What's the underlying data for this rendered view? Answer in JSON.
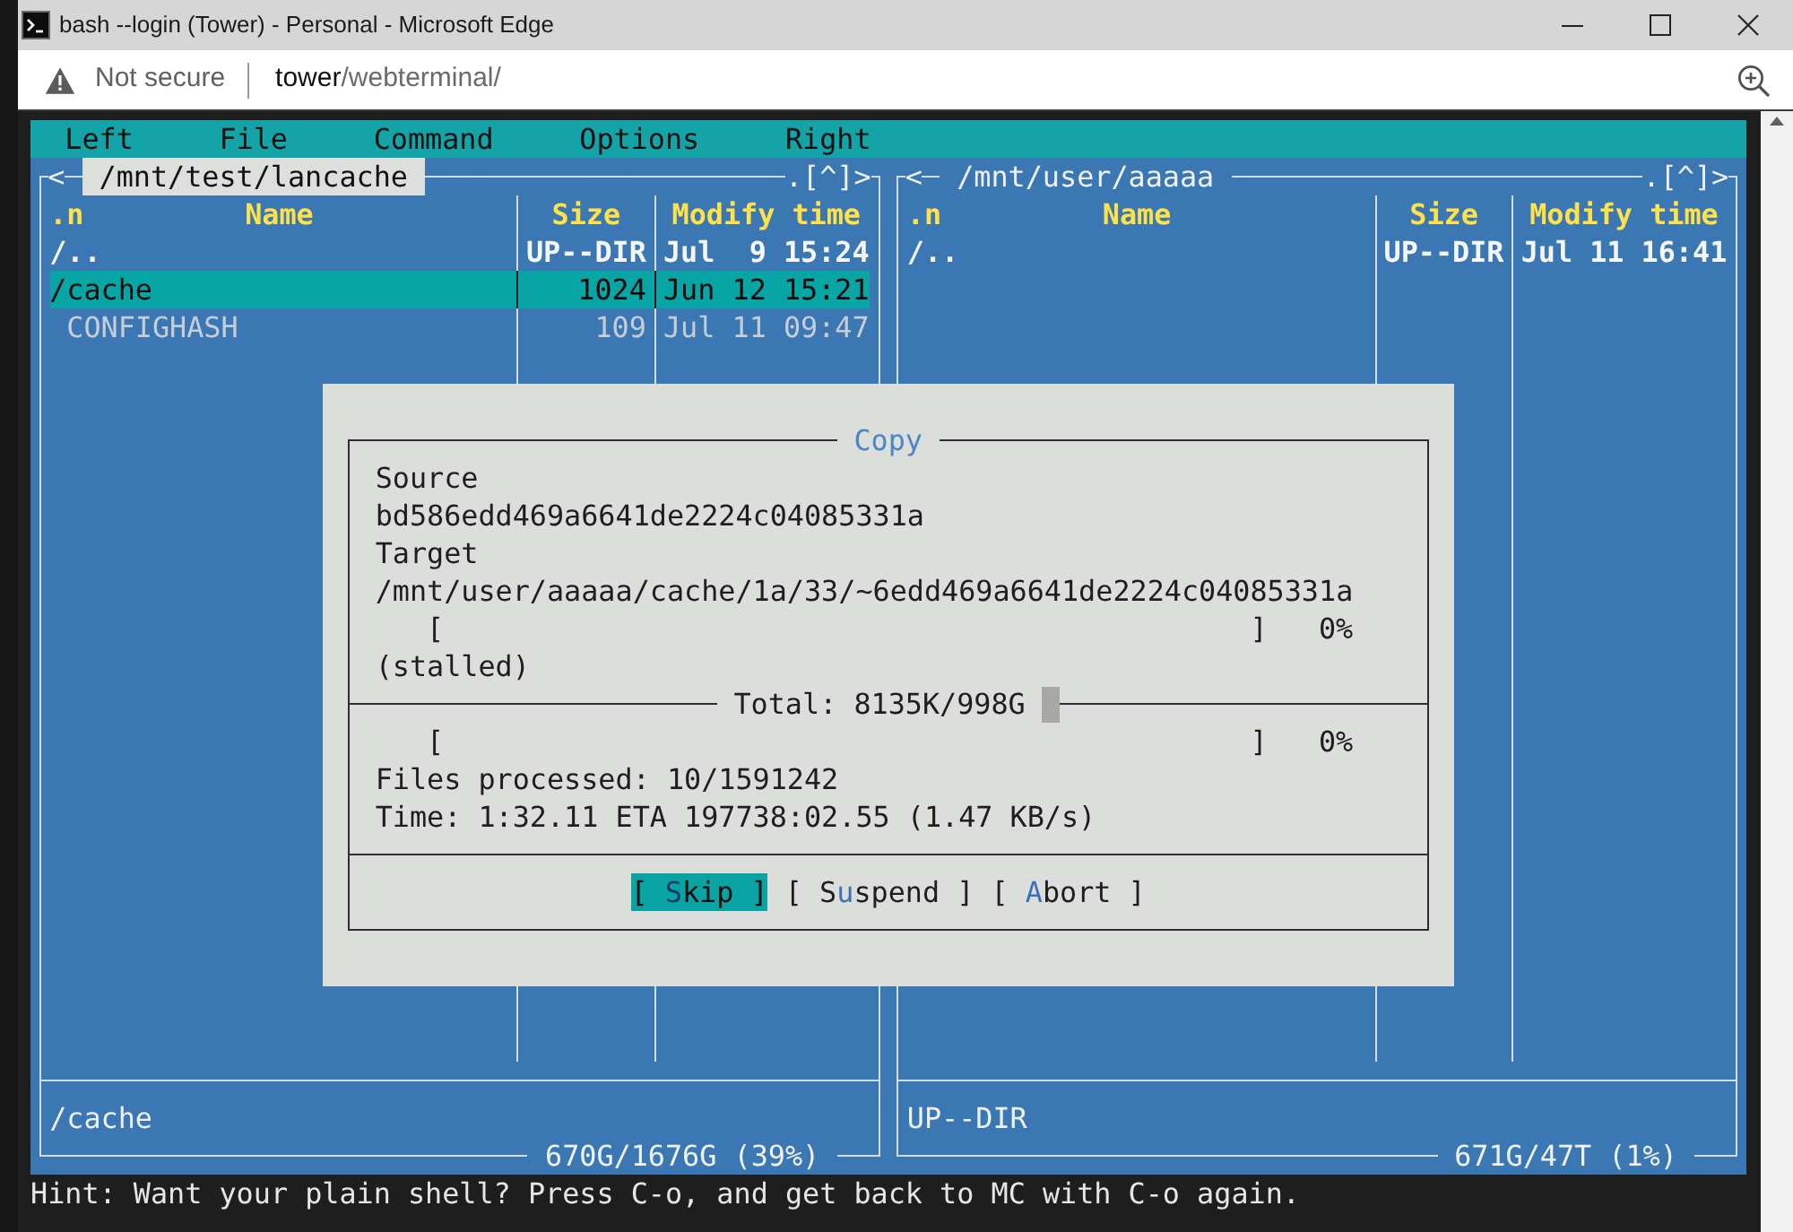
{
  "window": {
    "title": "bash --login (Tower) - Personal - Microsoft Edge"
  },
  "address_bar": {
    "security": "Not secure",
    "host": "tower",
    "path": "/webterminal/"
  },
  "menu_bar": [
    "Left",
    "File",
    "Command",
    "Options",
    "Right"
  ],
  "panels": [
    {
      "active": true,
      "title_left": "<",
      "path": "/mnt/test/lancache",
      "title_right": ".[^]>",
      "sort_indicator": ".n",
      "columns": [
        "Name",
        "Size",
        "Modify time"
      ],
      "rows": [
        {
          "kind": "dir",
          "name": "/..",
          "size": "UP--DIR",
          "modified": "Jul  9 15:24",
          "selected": false
        },
        {
          "kind": "dir",
          "name": "/cache",
          "size": "1024",
          "modified": "Jun 12 15:21",
          "selected": true
        },
        {
          "kind": "file",
          "name": "CONFIGHASH",
          "size": "109",
          "modified": "Jul 11 09:47",
          "selected": false
        }
      ],
      "mini_status": "/cache",
      "disk_info": "670G/1676G (39%)"
    },
    {
      "active": false,
      "title_left": "<",
      "path": "/mnt/user/aaaaa",
      "title_right": ".[^]>",
      "sort_indicator": ".n",
      "columns": [
        "Name",
        "Size",
        "Modify time"
      ],
      "rows": [
        {
          "kind": "dir",
          "name": "/..",
          "size": "UP--DIR",
          "modified": "Jul 11 16:41",
          "selected": false
        }
      ],
      "mini_status": "UP--DIR",
      "disk_info": "671G/47T (1%)"
    }
  ],
  "copy_dialog": {
    "title": "Copy",
    "source_label": "Source",
    "source": "bd586edd469a6641de2224c04085331a",
    "target_label": "Target",
    "target": "/mnt/user/aaaaa/cache/1a/33/~6edd469a6641de2224c04085331a",
    "file_progress": {
      "open": "[",
      "close": "]",
      "level": 0,
      "percent": "0%"
    },
    "file_status": "(stalled)",
    "total": "Total: 8135K/998G",
    "total_progress": {
      "open": "[",
      "close": "]",
      "level": 0,
      "percent": "0%"
    },
    "files_processed": "Files processed: 10/1591242",
    "time": "Time: 1:32.11 ETA 197738:02.55 (1.47 KB/s)",
    "buttons": [
      {
        "open": "[",
        "hotkey": "S",
        "rest": "kip",
        "close": "]",
        "selected": true
      },
      {
        "open": "[",
        "lead": "S",
        "hotkey": "u",
        "rest": "spend",
        "close": "]",
        "selected": false
      },
      {
        "open": "[",
        "hotkey": "A",
        "rest": "bort",
        "close": "]",
        "selected": false
      }
    ]
  },
  "hint": "Hint: Want your plain shell? Press C-o, and get back to MC with C-o again."
}
